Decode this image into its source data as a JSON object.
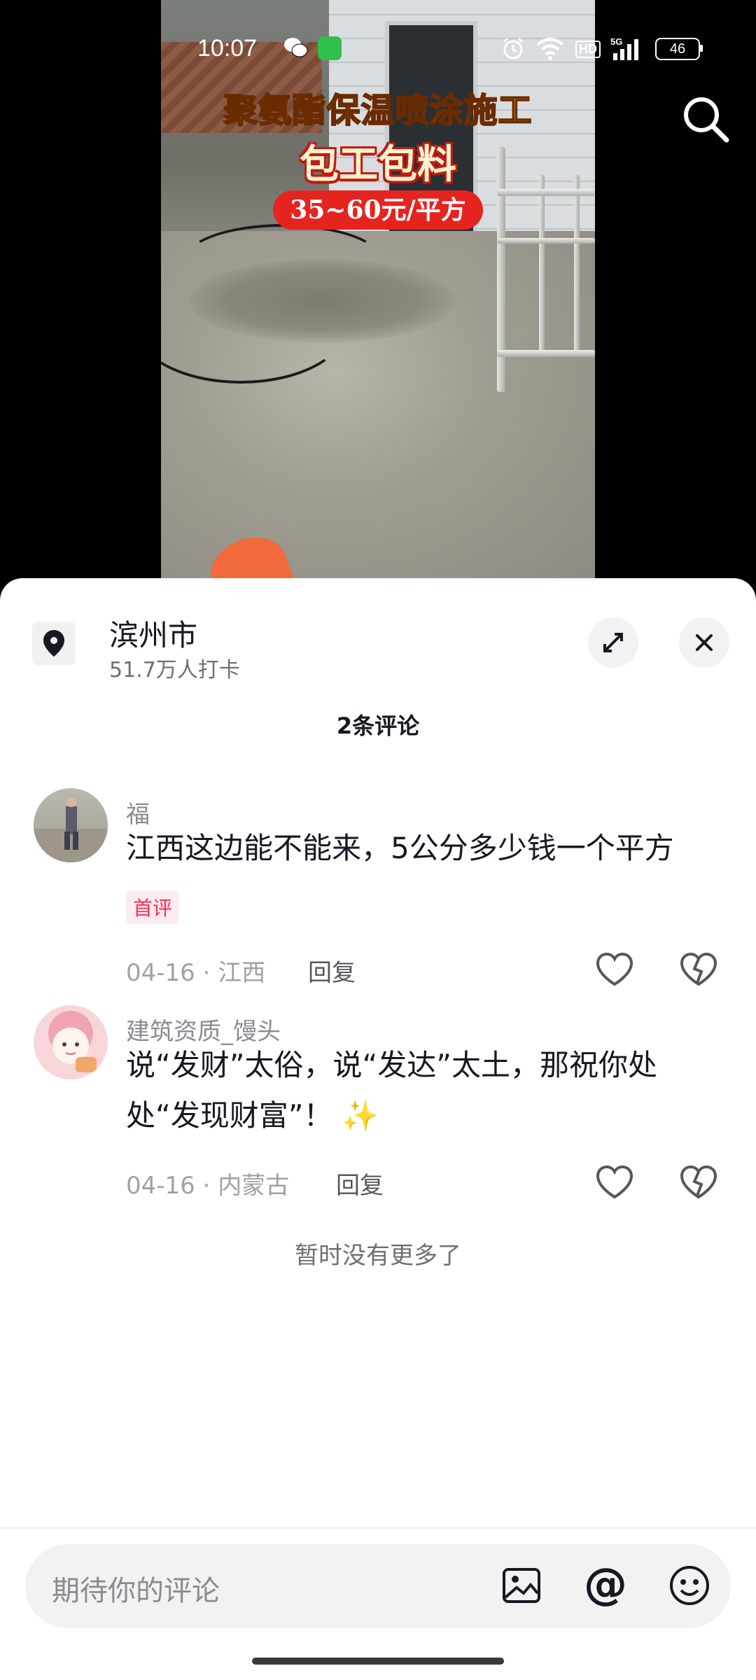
{
  "status_bar": {
    "time": "10:07",
    "hd": "HD",
    "network": "5G",
    "battery": "46"
  },
  "video": {
    "title_line1": "聚氨酯保温喷涂施工",
    "title_line2": "包工包料",
    "price": "35~60元/平方"
  },
  "location": {
    "name": "滨州市",
    "checkins": "51.7万人打卡"
  },
  "comments_header": "2条评论",
  "comments": [
    {
      "user": "福",
      "text": "江西这边能不能来，5公分多少钱一个平方",
      "tag": "首评",
      "date": "04-16",
      "region": "江西",
      "reply": "回复"
    },
    {
      "user": "建筑资质_馒头",
      "text": "说“发财”太俗，说“发达”太土，那祝你处处“发现财富”！ ✨",
      "date": "04-16",
      "region": "内蒙古",
      "reply": "回复"
    }
  ],
  "no_more": "暂时没有更多了",
  "input": {
    "placeholder": "期待你的评论",
    "at": "@"
  },
  "colors": {
    "accent_red": "#fe2c55",
    "price_red": "#e52420",
    "title_yellow": "#ffd64a"
  },
  "icons": [
    "wechat-icon",
    "app-icon",
    "alarm-icon",
    "wifi-icon",
    "signal-icon",
    "search-icon",
    "location-pin-icon",
    "expand-icon",
    "close-icon",
    "heart-icon",
    "broken-heart-icon",
    "image-icon",
    "at-icon",
    "emoji-icon"
  ]
}
